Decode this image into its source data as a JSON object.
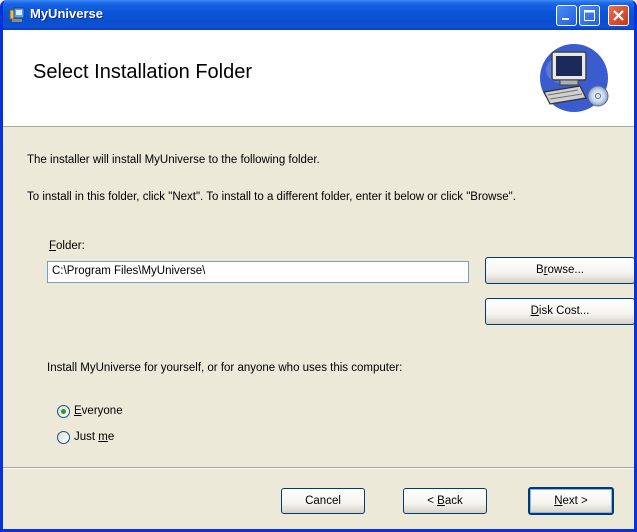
{
  "window": {
    "title": "MyUniverse",
    "header_title": "Select Installation Folder",
    "icons": {
      "app": "installer-app-icon",
      "header": "computer-disc-icon",
      "minimize": "minimize-icon",
      "maximize": "maximize-icon",
      "close": "close-icon"
    }
  },
  "body": {
    "intro_line1": "The installer will install MyUniverse to the following folder.",
    "intro_line2": "To install in this folder, click \"Next\". To install to a different folder, enter it below or click \"Browse\"."
  },
  "folder": {
    "label_accel": "F",
    "label_rest": "older:",
    "value": "C:\\Program Files\\MyUniverse\\"
  },
  "buttons": {
    "browse_pre": "B",
    "browse_accel": "r",
    "browse_post": "owse...",
    "diskcost_accel": "D",
    "diskcost_post": "isk Cost...",
    "cancel": "Cancel",
    "back_pre": "< ",
    "back_accel": "B",
    "back_post": "ack",
    "next_accel": "N",
    "next_post": "ext >"
  },
  "install_for": {
    "question": "Install MyUniverse for yourself, or for anyone who uses this computer:",
    "options": [
      {
        "accel": "E",
        "rest": "veryone",
        "selected": true
      },
      {
        "pre": "Just ",
        "accel": "m",
        "rest": "e",
        "selected": false
      }
    ]
  },
  "colors": {
    "titlebar": "#0a56d8",
    "window_bg": "#ece9d8",
    "header_bg": "#ffffff",
    "radio_selected": "#21a121"
  }
}
